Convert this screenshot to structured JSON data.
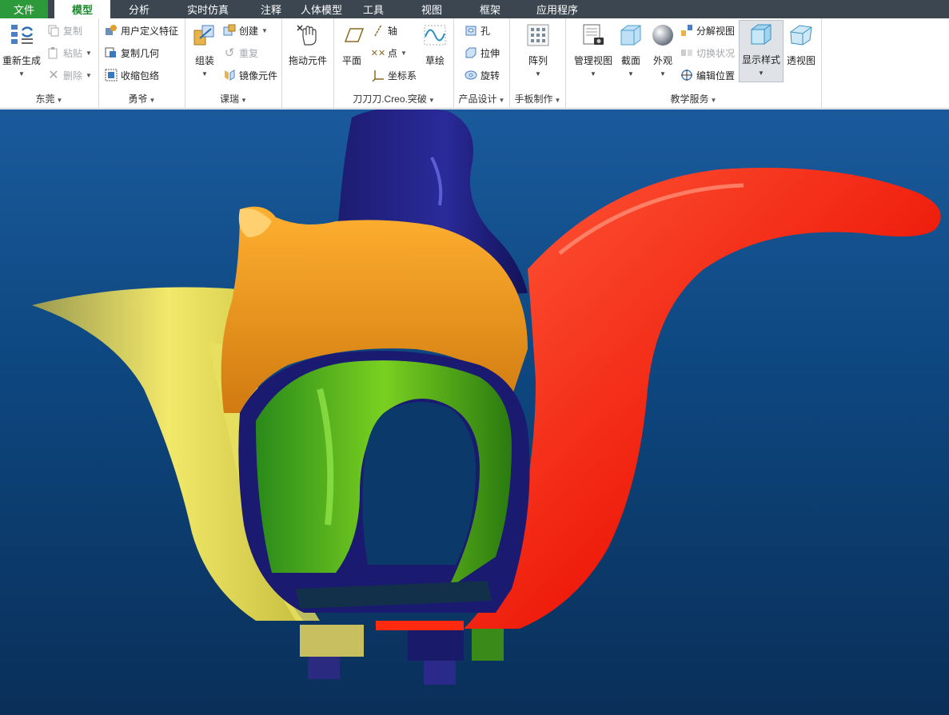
{
  "tabs": {
    "file": "文件",
    "model": "模型",
    "analysis": "分析",
    "realtime_sim": "实时仿真",
    "annotate": "注释",
    "human_model": "人体模型",
    "tools": "工具",
    "view": "视图",
    "framework": "框架",
    "applications": "应用程序"
  },
  "groups": {
    "g1": {
      "label": "东莞",
      "regenerate": "重新生成",
      "copy": "复制",
      "paste": "粘贴",
      "delete": "删除"
    },
    "g2": {
      "label": "勇爷",
      "udf": "用户定义特征",
      "copy_geom": "复制几何",
      "shrinkwrap": "收缩包络"
    },
    "g3": {
      "label": "课瑞",
      "assemble": "组装",
      "create": "创建",
      "repeat": "重复",
      "mirror": "镜像元件"
    },
    "g4": {
      "drag": "拖动元件"
    },
    "g5": {
      "label": "刀刀刀.Creo.突破",
      "plane": "平面",
      "axis": "轴",
      "point": "点",
      "csys": "坐标系",
      "sketch": "草绘"
    },
    "g6": {
      "label": "产品设计",
      "hole": "孔",
      "extrude": "拉伸",
      "revolve": "旋转"
    },
    "g7": {
      "label": "手板制作",
      "pattern": "阵列"
    },
    "g8": {
      "label": "教学服务",
      "manage_views": "管理视图",
      "section": "截面",
      "appearance": "外观",
      "explode_view": "分解视图",
      "toggle_status": "切换状况",
      "edit_position": "编辑位置",
      "display_style": "显示样式",
      "perspective": "透视图"
    }
  },
  "colors": {
    "tabbar": "#3b4650",
    "file_tab": "#2c9a3a",
    "model_tab_text": "#1b8a2c",
    "viewport_top": "#1a5a9c",
    "viewport_bottom": "#0a2f59"
  }
}
